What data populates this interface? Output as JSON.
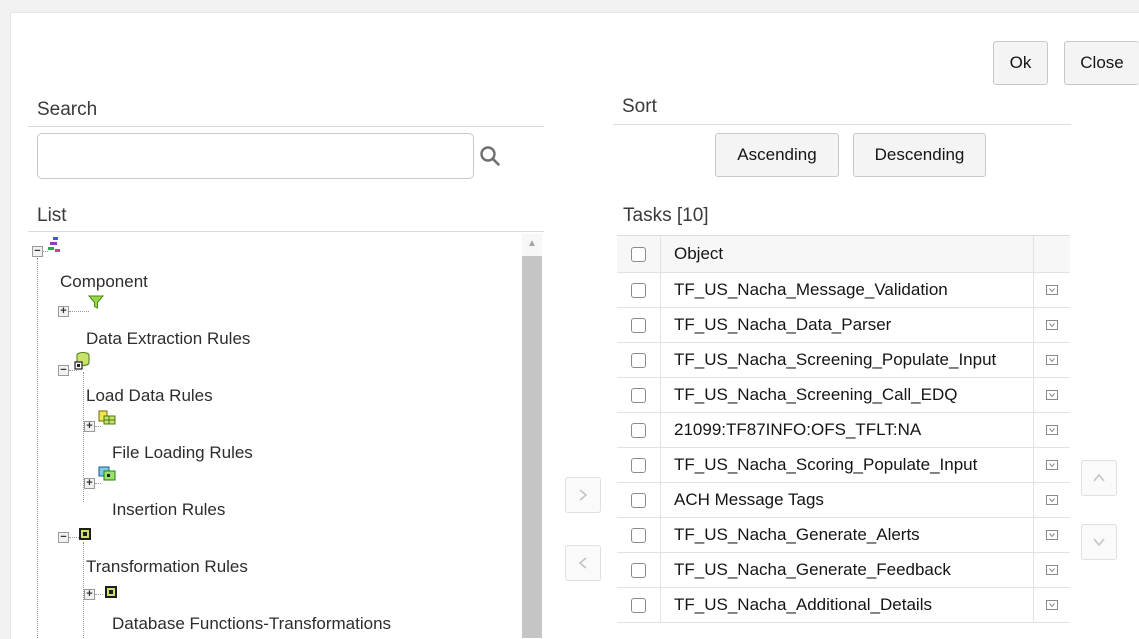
{
  "dialog": {
    "ok_label": "Ok",
    "close_label": "Close"
  },
  "search": {
    "title": "Search",
    "value": "",
    "placeholder": ""
  },
  "sort": {
    "title": "Sort",
    "ascending_label": "Ascending",
    "descending_label": "Descending"
  },
  "list": {
    "title": "List",
    "nodes": {
      "component": "Component",
      "data_extraction_rules": "Data Extraction Rules",
      "load_data_rules": "Load Data Rules",
      "file_loading_rules": "File Loading Rules",
      "insertion_rules": "Insertion Rules",
      "transformation_rules": "Transformation Rules",
      "db_functions_transformations": "Database Functions-Transformations"
    },
    "icons": {
      "root": "hierarchy-icon",
      "data_extraction": "filter-icon",
      "load_data": "database-icon",
      "file_loading": "file-table-icon",
      "insertion": "insert-icon",
      "transformation": "transform-icon"
    }
  },
  "tasks": {
    "title": "Tasks [10]",
    "column_header": "Object",
    "rows": [
      "TF_US_Nacha_Message_Validation",
      "TF_US_Nacha_Data_Parser",
      "TF_US_Nacha_Screening_Populate_Input",
      "TF_US_Nacha_Screening_Call_EDQ",
      "21099:TF87INFO:OFS_TFLT:NA",
      "TF_US_Nacha_Scoring_Populate_Input",
      "ACH Message Tags",
      "TF_US_Nacha_Generate_Alerts",
      "TF_US_Nacha_Generate_Feedback",
      "TF_US_Nacha_Additional_Details"
    ]
  },
  "colors": {
    "panel_bg": "#ffffff",
    "page_bg": "#f2f2f2",
    "button_bg": "#f4f4f4",
    "scroll_thumb": "#c5c5c5"
  }
}
